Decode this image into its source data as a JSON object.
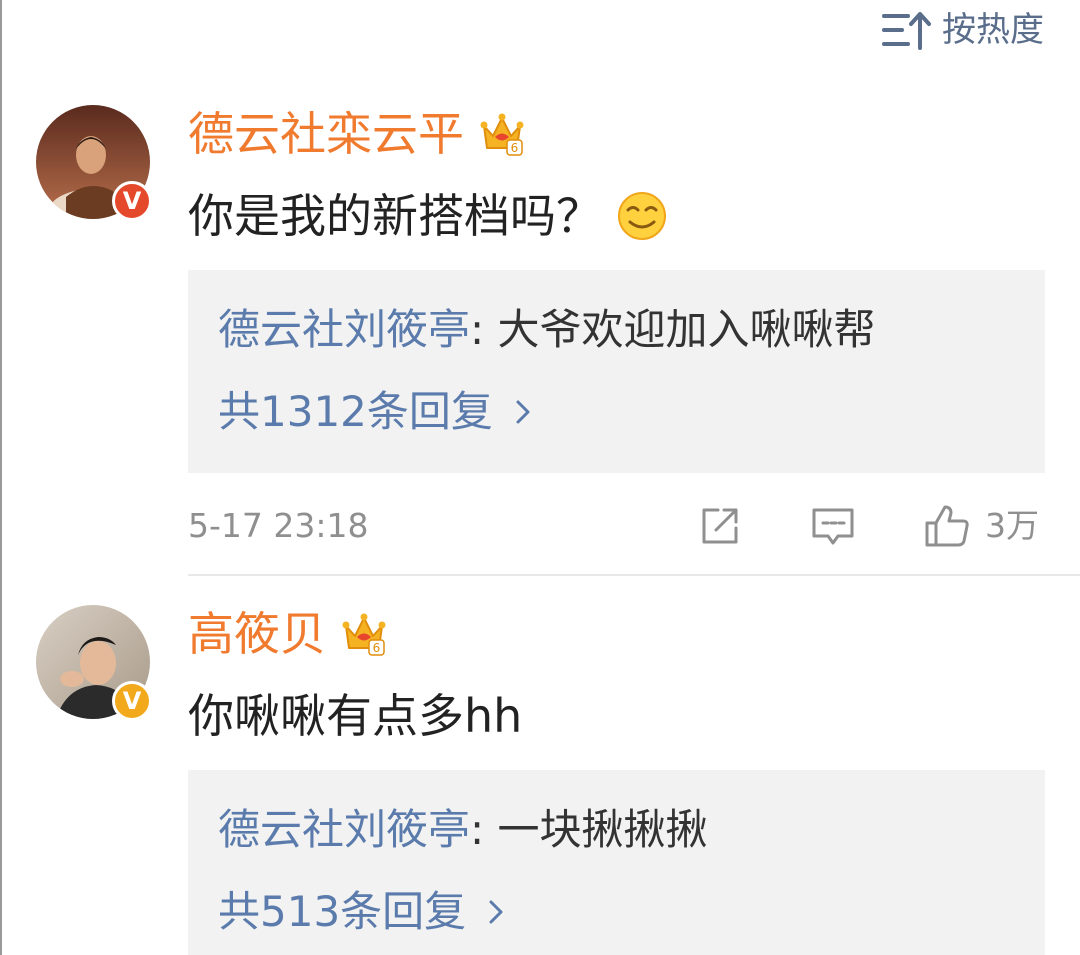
{
  "sort": {
    "icon": "sort-by-heat-icon",
    "label": "按热度"
  },
  "colors": {
    "username": "#f07a2e",
    "reply_author": "#5a7bab",
    "meta": "#8f8f8f",
    "reply_bg": "#f2f2f2",
    "verify_red": "#e5492b",
    "verify_gold": "#f2a91c"
  },
  "comments": [
    {
      "username": "德云社栾云平",
      "verify": "V",
      "verify_color": "red",
      "member_level": "6",
      "text": "你是我的新搭档吗？",
      "emoji": "smirk-emoji-icon",
      "reply": {
        "author": "德云社刘筱亭",
        "separator": ": ",
        "text": "大爷欢迎加入啾啾帮",
        "count_label": "共1312条回复"
      },
      "timestamp": "5-17 23:18",
      "likes": "3万"
    },
    {
      "username": "高筱贝",
      "verify": "V",
      "verify_color": "gold",
      "member_level": "6",
      "text": "你啾啾有点多hh",
      "reply": {
        "author": "德云社刘筱亭",
        "separator": ": ",
        "text": "一块揪揪揪",
        "count_label": "共513条回复"
      }
    }
  ]
}
